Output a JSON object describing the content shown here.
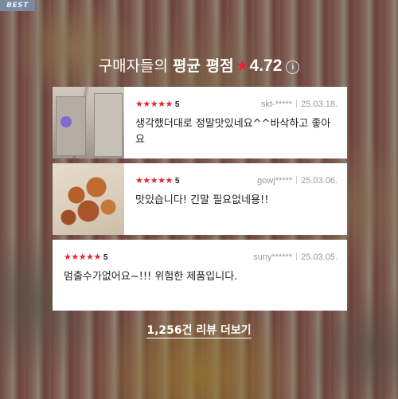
{
  "badge": {
    "label": "BEST"
  },
  "summary": {
    "lead": "구매자들의",
    "strong": "평균 평점",
    "star": "★",
    "score": "4.72",
    "info_icon": "info-icon",
    "info_glyph": "i"
  },
  "reviews": [
    {
      "stars": "★★★★★",
      "rating": "5",
      "user": "skt-*****",
      "date": "25.03.18.",
      "text": "생각했더대로 정말맛있네요^^바삭하고 좋아요",
      "thumbnail": "photo of two paper bags"
    },
    {
      "stars": "★★★★★",
      "rating": "5",
      "user": "gowj*****",
      "date": "25.03.06.",
      "text": "맛있습니다! 긴말 필요없네용!!",
      "thumbnail": "photo of fried snack pieces"
    },
    {
      "stars": "★★★★★",
      "rating": "5",
      "user": "suny******",
      "date": "25.03.05.",
      "text": "멈출수가없어요~!!! 위험한 제품입니다."
    }
  ],
  "more": {
    "label": "1,256건 리뷰 더보기"
  },
  "colors": {
    "star": "#e32434",
    "badge": "#7a8aa0"
  }
}
